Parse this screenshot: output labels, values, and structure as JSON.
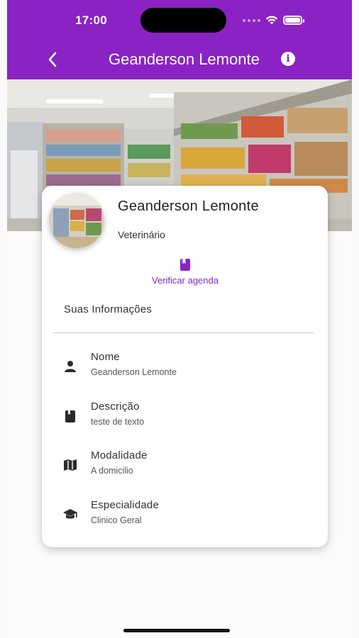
{
  "status_bar": {
    "time": "17:00"
  },
  "app_bar": {
    "title": "Geanderson Lemonte",
    "icons": {
      "back": "chevron-left-icon",
      "info": "info-icon"
    }
  },
  "profile": {
    "name": "Geanderson Lemonte",
    "role": "Veterinário"
  },
  "agenda": {
    "label": "Verificar agenda",
    "icon": "book-icon"
  },
  "section_title": "Suas Informações",
  "info": [
    {
      "label": "Nome",
      "value": "Geanderson Lemonte",
      "icon": "person-icon"
    },
    {
      "label": "Descrição",
      "value": "teste de texto",
      "icon": "book-icon"
    },
    {
      "label": "Modalidade",
      "value": "A domicilio",
      "icon": "map-icon"
    },
    {
      "label": "Especialidade",
      "value": "Clinico Geral",
      "icon": "graduation-cap-icon"
    }
  ],
  "colors": {
    "primary": "#8a22c4",
    "accent": "#7b2ab7",
    "icon_dark": "#2b2b2b"
  }
}
